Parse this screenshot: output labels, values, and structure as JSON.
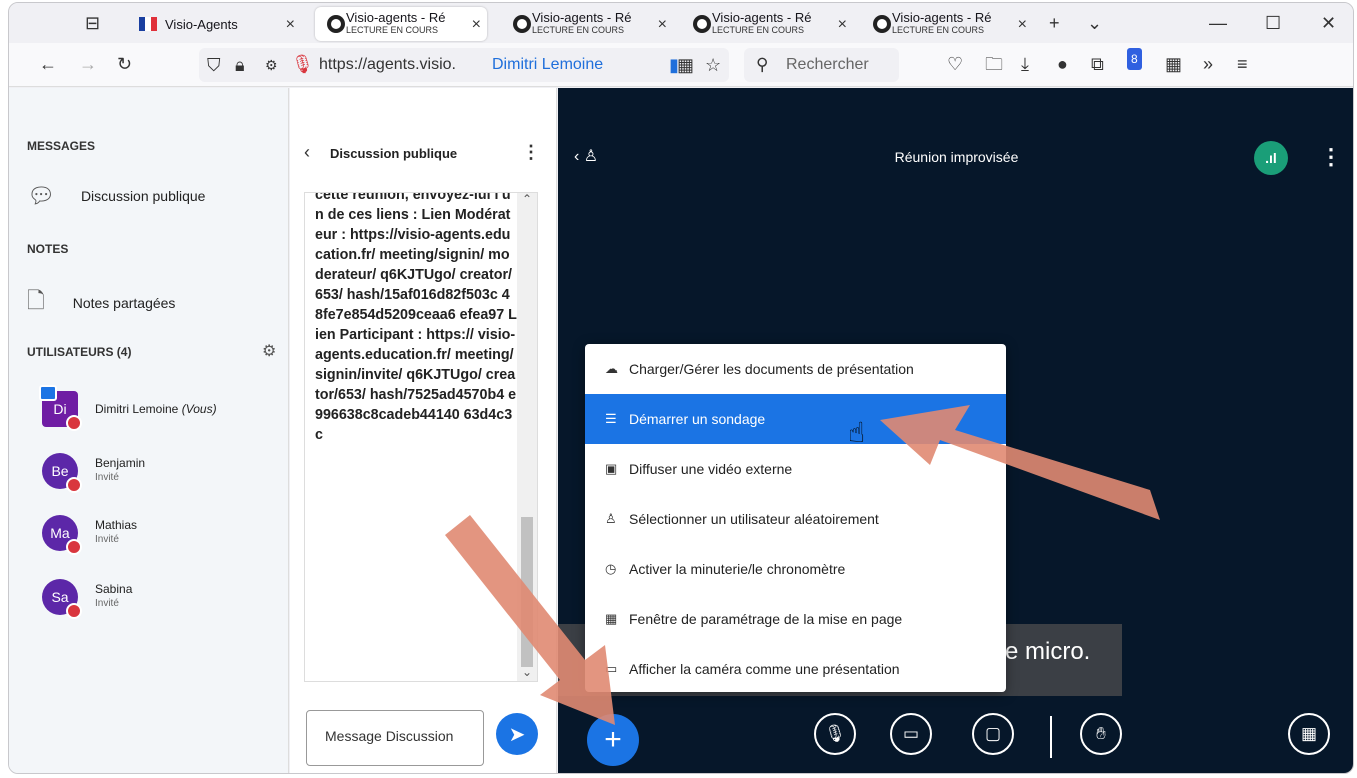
{
  "browser": {
    "tabs": [
      {
        "label": "Visio-Agents",
        "sub": ""
      },
      {
        "label": "Visio-agents - Ré",
        "sub": "LECTURE EN COURS"
      },
      {
        "label": "Visio-agents - Ré",
        "sub": "LECTURE EN COURS"
      },
      {
        "label": "Visio-agents - Ré",
        "sub": "LECTURE EN COURS"
      },
      {
        "label": "Visio-agents - Ré",
        "sub": "LECTURE EN COURS"
      }
    ],
    "url": "https://agents.visio.",
    "url_user": "Dimitri Lemoine",
    "search_placeholder": "Rechercher",
    "badge_count": "8"
  },
  "sidebar": {
    "messages_title": "MESSAGES",
    "public_chat": "Discussion publique",
    "notes_title": "NOTES",
    "shared_notes": "Notes partagées",
    "users_title": "UTILISATEURS (4)",
    "users": [
      {
        "initials": "Di",
        "name": "Dimitri Lemoine",
        "suffix": "(Vous)",
        "role": "",
        "color": "#6f1da4"
      },
      {
        "initials": "Be",
        "name": "Benjamin",
        "suffix": "",
        "role": "Invité",
        "color": "#5c27a8"
      },
      {
        "initials": "Ma",
        "name": "Mathias",
        "suffix": "",
        "role": "Invité",
        "color": "#5c27a8"
      },
      {
        "initials": "Sa",
        "name": "Sabina",
        "suffix": "",
        "role": "Invité",
        "color": "#5c27a8"
      }
    ]
  },
  "chat": {
    "title": "Discussion publique",
    "message": "cette réunion, envoyez-lui l'un de ces liens : Lien Modérateur : https://visio-agents.education.fr/ meeting/signin/ moderateur/ q6KJTUgo/ creator/653/ hash/15af016d82f503c 48fe7e854d5209ceaa6 efea97 Lien Participant : https:// visio-agents.education.fr/ meeting/signin/invite/ q6KJTUgo/ creator/653/ hash/7525ad4570b4 e996638c8cadeb44140 63d4c3c",
    "input_placeholder": "Message Discussion"
  },
  "meeting": {
    "title": "Réunion improvisée",
    "notice_fragment": "e micro.",
    "menu": [
      {
        "icon": "☁",
        "label": "Charger/Gérer les documents de présentation",
        "selected": false
      },
      {
        "icon": "☰",
        "label": "Démarrer un sondage",
        "selected": true
      },
      {
        "icon": "▣",
        "label": "Diffuser une vidéo externe",
        "selected": false
      },
      {
        "icon": "♙",
        "label": "Sélectionner un utilisateur aléatoirement",
        "selected": false
      },
      {
        "icon": "◷",
        "label": "Activer la minuterie/le chronomètre",
        "selected": false
      },
      {
        "icon": "▦",
        "label": "Fenêtre de paramétrage de la mise en page",
        "selected": false
      },
      {
        "icon": "▭",
        "label": "Afficher la caméra comme une présentation",
        "selected": false
      }
    ]
  },
  "colors": {
    "accent": "#1b74e4",
    "meeting_bg": "#06172a",
    "arrow": "#e08a72"
  }
}
